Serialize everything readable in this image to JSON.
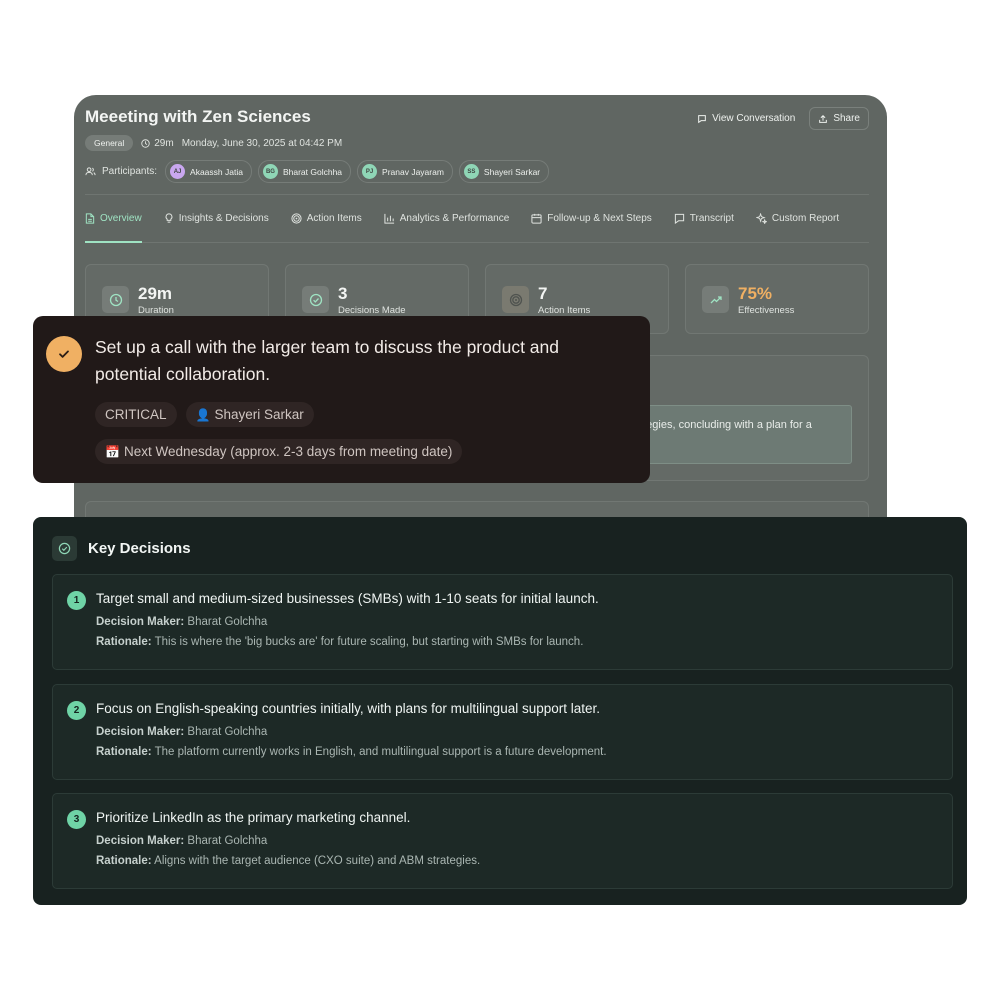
{
  "meeting": {
    "title": "Meeeting with Zen Sciences",
    "view_conversation_label": "View Conversation",
    "share_label": "Share",
    "tag": "General",
    "duration": "29m",
    "datetime": "Monday, June 30, 2025 at 04:42 PM",
    "participants_label": "Participants:",
    "participants": [
      {
        "initials": "AJ",
        "name": "Akaassh Jatia",
        "color": "#c9a7f0"
      },
      {
        "initials": "BG",
        "name": "Bharat Golchha",
        "color": "#8fd6b6"
      },
      {
        "initials": "PJ",
        "name": "Pranav Jayaram",
        "color": "#8fd6b6"
      },
      {
        "initials": "SS",
        "name": "Shayeri Sarkar",
        "color": "#8fd6b6"
      }
    ],
    "tabs": [
      {
        "label": "Overview",
        "icon": "document-icon",
        "active": true
      },
      {
        "label": "Insights & Decisions",
        "icon": "lightbulb-icon"
      },
      {
        "label": "Action Items",
        "icon": "target-icon"
      },
      {
        "label": "Analytics & Performance",
        "icon": "bar-chart-icon"
      },
      {
        "label": "Follow-up & Next Steps",
        "icon": "calendar-icon"
      },
      {
        "label": "Transcript",
        "icon": "chat-icon"
      },
      {
        "label": "Custom Report",
        "icon": "sparkle-icon"
      }
    ],
    "stats": [
      {
        "value": "29m",
        "label": "Duration",
        "icon": "clock-icon",
        "color": "#f3f5f3"
      },
      {
        "value": "3",
        "label": "Decisions Made",
        "icon": "check-circle-icon",
        "color": "#f3f5f3"
      },
      {
        "value": "7",
        "label": "Action Items",
        "icon": "target-icon",
        "color": "#f3f5f3"
      },
      {
        "value": "75%",
        "label": "Effectiveness",
        "icon": "trending-up-icon",
        "color": "#f0b063"
      }
    ],
    "summary_fragment": "ategies, concluding with a plan for a"
  },
  "action_item": {
    "text": "Set up a call with the larger team to discuss the product and potential collaboration.",
    "priority": "CRITICAL",
    "assignee": "Shayeri Sarkar",
    "due": "Next Wednesday (approx. 2-3 days from meeting date)",
    "accent": "#f0b063"
  },
  "key_decisions": {
    "title": "Key Decisions",
    "maker_label": "Decision Maker:",
    "rationale_label": "Rationale:",
    "items": [
      {
        "num": "1",
        "text": "Target small and medium-sized businesses (SMBs) with 1-10 seats for initial launch.",
        "maker": "Bharat Golchha",
        "rationale": "This is where the 'big bucks are' for future scaling, but starting with SMBs for launch."
      },
      {
        "num": "2",
        "text": "Focus on English-speaking countries initially, with plans for multilingual support later.",
        "maker": "Bharat Golchha",
        "rationale": "The platform currently works in English, and multilingual support is a future development."
      },
      {
        "num": "3",
        "text": "Prioritize LinkedIn as the primary marketing channel.",
        "maker": "Bharat Golchha",
        "rationale": "Aligns with the target audience (CXO suite) and ABM strategies."
      }
    ]
  }
}
